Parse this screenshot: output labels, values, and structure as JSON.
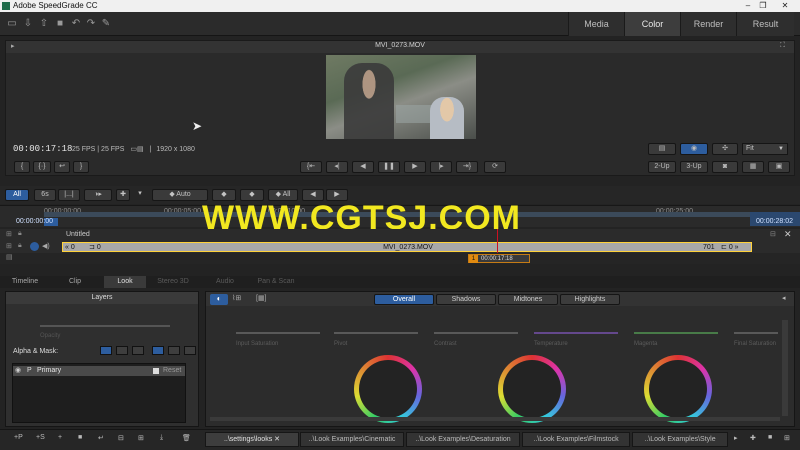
{
  "window": {
    "title": "Adobe SpeedGrade CC",
    "controls": [
      "–",
      "❐",
      "✕"
    ]
  },
  "toolbar": {
    "icons": [
      "folder-open-icon",
      "import-icon",
      "export-icon",
      "save-icon",
      "undo-icon",
      "redo-icon",
      "wrench-icon"
    ],
    "nav_tabs": [
      {
        "label": "Media",
        "active": false
      },
      {
        "label": "Color",
        "active": true
      },
      {
        "label": "Render",
        "active": false
      },
      {
        "label": "Result",
        "active": false
      }
    ]
  },
  "viewer": {
    "clip_name": "MVI_0273.MOV",
    "timecode": "00:00:17:18",
    "fps_info": "25 FPS  |  25 FPS",
    "resolution": "1920 x 1080",
    "zoom": "Fit",
    "buttons": {
      "two_up": "2-Up",
      "three_up": "3-Up"
    }
  },
  "timeline_controls": {
    "all": "All",
    "six_s": "6s",
    "ellipsis": "|...|",
    "auto": "◆ Auto",
    "all2": "◆ All"
  },
  "ruler": {
    "ticks": [
      "00:00:00:00",
      "00:00:05:00",
      "00:00:10:00",
      "00:00:25:00"
    ],
    "in_tc": "00:00:00:00",
    "out_tc": "00:00:28:02"
  },
  "watermark": "WWW.CGTSJ.COM",
  "tracks": {
    "track_title": "Untitled",
    "clip_label": "MVI_0273.MOV",
    "left_count": "0",
    "left_count2": "0",
    "right_count": "701",
    "right_count2": "0",
    "playhead_num": "1",
    "playhead_tc": "00:00:17:18"
  },
  "bottom_tabs": [
    {
      "label": "Timeline",
      "state": "normal"
    },
    {
      "label": "Clip",
      "state": "normal"
    },
    {
      "label": "Look",
      "state": "active"
    },
    {
      "label": "Stereo 3D",
      "state": "dim"
    },
    {
      "label": "Audio",
      "state": "dim"
    },
    {
      "label": "Pan & Scan",
      "state": "dim"
    }
  ],
  "layers": {
    "title": "Layers",
    "opacity_label": "Opacity",
    "alpha_mask_label": "Alpha & Mask:",
    "primary_row": {
      "letter": "P",
      "name": "Primary",
      "reset": "Reset"
    }
  },
  "look": {
    "tabs": [
      "Overall",
      "Shadows",
      "Midtones",
      "Highlights"
    ],
    "active_tab": "Overall",
    "sliders": [
      "Input Saturation",
      "Pivot",
      "Contrast",
      "Temperature",
      "Magenta",
      "Final Saturation"
    ],
    "slider_colors": [
      "#777777",
      "#777777",
      "#777777",
      "#8a5acd",
      "#5ab05a",
      "#777777"
    ]
  },
  "bottom_bar": {
    "tools": [
      "+P",
      "+S",
      "+",
      "■",
      "↵",
      "⊟",
      "⊞",
      "⤓",
      "🗑"
    ],
    "look_tabs": [
      "..\\settings\\looks",
      "..\\Look Examples\\Cinematic",
      "..\\Look Examples\\Desaturation",
      "..\\Look Examples\\Filmstock",
      "..\\Look Examples\\Style"
    ]
  }
}
